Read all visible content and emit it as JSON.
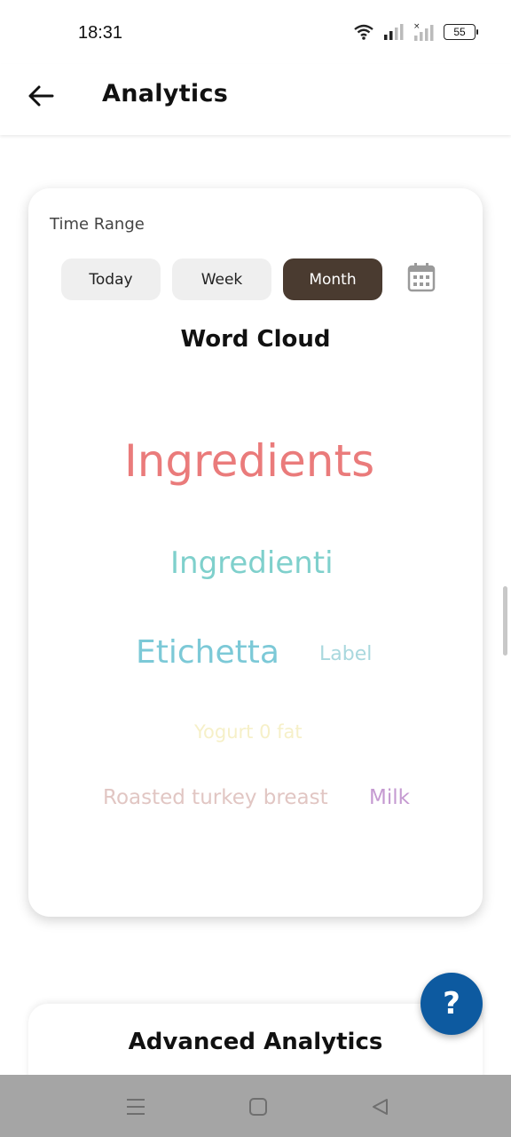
{
  "status_bar": {
    "time": "18:31",
    "battery": "55",
    "icons": [
      "wifi-icon",
      "signal-icon",
      "signal-icon",
      "battery-icon"
    ]
  },
  "app_bar": {
    "title": "Analytics",
    "back_icon": "arrow-left-icon"
  },
  "time_range": {
    "label": "Time Range",
    "options": [
      "Today",
      "Week",
      "Month"
    ],
    "selected": "Month",
    "calendar_icon": "calendar-icon"
  },
  "word_cloud": {
    "title": "Word Cloud",
    "words": [
      {
        "text": "Ingredients",
        "color": "#ea7b7b"
      },
      {
        "text": "Ingredienti",
        "color": "#7fd0cc"
      },
      {
        "text": "Etichetta",
        "color": "#7cc9d7"
      },
      {
        "text": "Label",
        "color": "#a9d8de"
      },
      {
        "text": "Yogurt 0 fat",
        "color": "#f6f0c8"
      },
      {
        "text": "Roasted turkey breast",
        "color": "#e1c6c3"
      },
      {
        "text": "Milk",
        "color": "#c59ad1"
      }
    ]
  },
  "advanced": {
    "title": "Advanced Analytics"
  },
  "help_button": {
    "label": "?"
  },
  "colors": {
    "active_button": "#4a3b30",
    "fab": "#0d5aa0"
  },
  "nav_icons": [
    "menu-icon",
    "home-icon",
    "back-triangle-icon"
  ]
}
